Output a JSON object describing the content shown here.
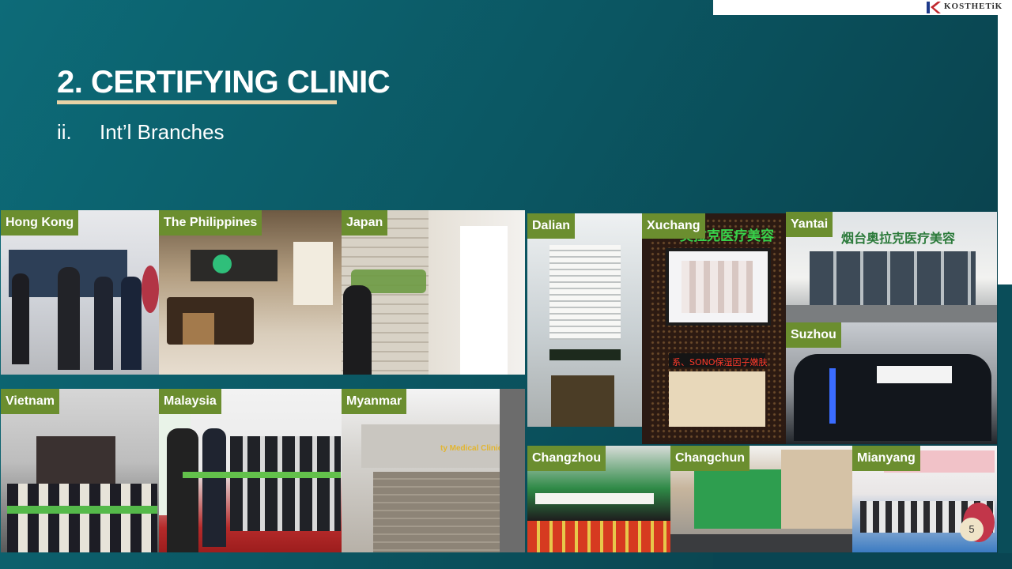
{
  "brand": {
    "logo_text": "KOSTHETiK"
  },
  "slide": {
    "title": "2. CERTIFYING CLINIC",
    "subtitle_num": "ii.",
    "subtitle_text": "Int’l Branches",
    "page_number": "5"
  },
  "branches": [
    {
      "label": "Hong Kong"
    },
    {
      "label": "The Philippines"
    },
    {
      "label": "Japan"
    },
    {
      "label": "Vietnam"
    },
    {
      "label": "Malaysia"
    },
    {
      "label": "Myanmar"
    },
    {
      "label": "Dalian"
    },
    {
      "label": "Xuchang"
    },
    {
      "label": "Yantai"
    },
    {
      "label": "Suzhou"
    },
    {
      "label": "Changzhou"
    },
    {
      "label": "Changchun"
    },
    {
      "label": "Mianyang"
    }
  ],
  "photo_signs": {
    "myanmar": "ty Medical Clinic",
    "xuchang_top": "奥拉克医疗美容",
    "yantai": "烟台奥拉克医疗美容",
    "xuchang_led": "系、SONO保湿因子嫩肤"
  }
}
